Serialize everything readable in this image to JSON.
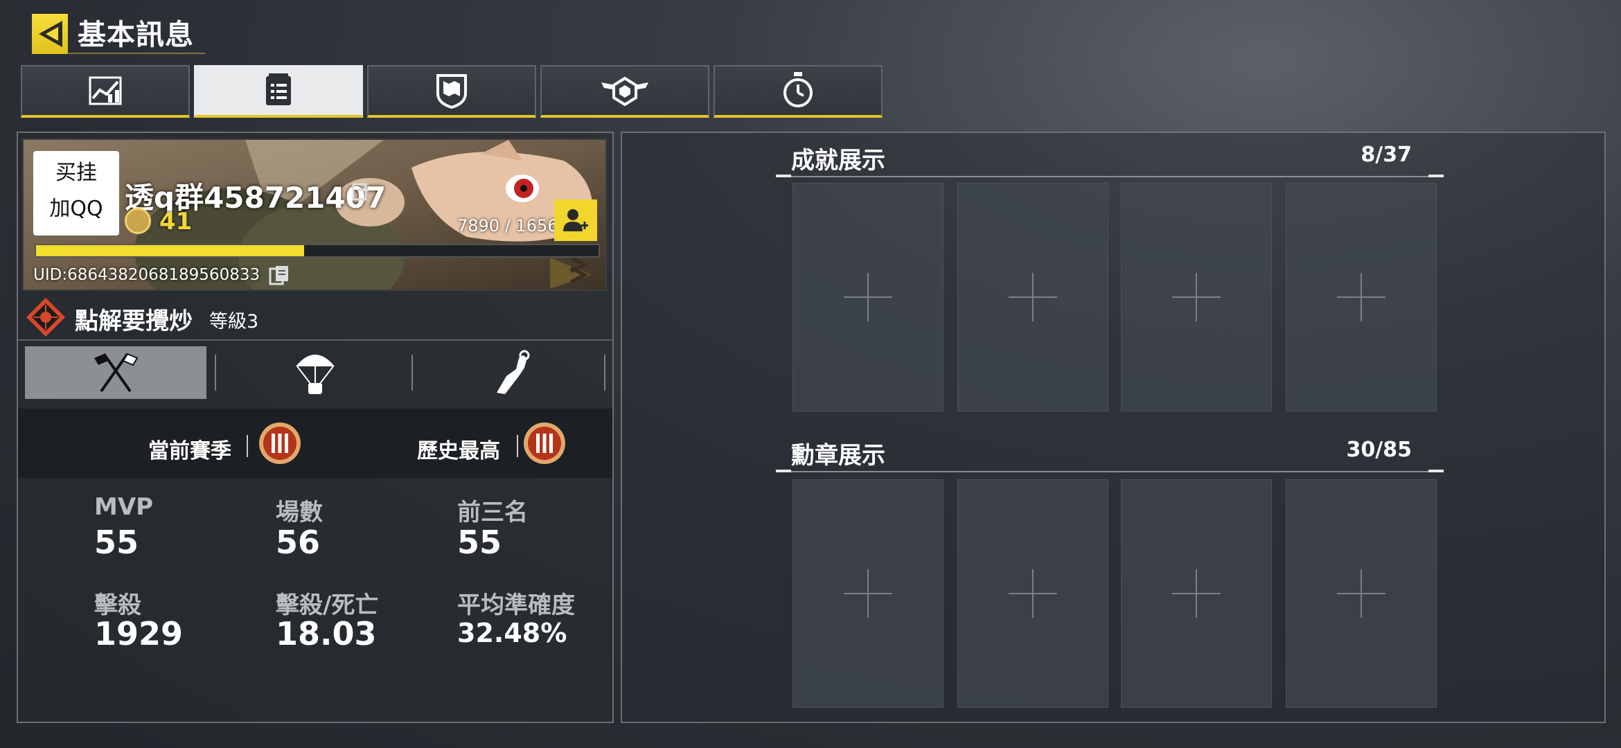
{
  "header": {
    "title": "基本訊息"
  },
  "tabs": [
    {
      "icon": "stats-chart-icon",
      "active": false
    },
    {
      "icon": "document-list-icon",
      "active": true
    },
    {
      "icon": "map-shield-icon",
      "active": false
    },
    {
      "icon": "winged-badge-icon",
      "active": false
    },
    {
      "icon": "stopwatch-icon",
      "active": false
    }
  ],
  "profile": {
    "promo_line1": "买挂",
    "promo_line2": "加QQ",
    "name": "透q群458721407",
    "level": "41",
    "xp_text": "7890 / 16560",
    "xp_fraction": 0.476,
    "uid": "UID:6864382068189560833"
  },
  "clan": {
    "name": "點解要攪炒",
    "level": "等級3"
  },
  "mode_tabs": [
    {
      "icon": "crossed-flags-icon",
      "active": true
    },
    {
      "icon": "parachute-icon",
      "active": false
    },
    {
      "icon": "arm-icon",
      "active": false
    }
  ],
  "ranks": {
    "current_label": "當前賽季",
    "best_label": "歷史最高"
  },
  "stats": [
    {
      "label": "MVP",
      "value": "55"
    },
    {
      "label": "場數",
      "value": "56"
    },
    {
      "label": "前三名",
      "value": "55"
    },
    {
      "label": "擊殺",
      "value": "1929"
    },
    {
      "label": "擊殺/死亡",
      "value": "18.03"
    },
    {
      "label": "平均準確度",
      "value": "32.48%"
    }
  ],
  "achievements": {
    "title": "成就展示",
    "count": "8/37"
  },
  "medals": {
    "title": "勳章展示",
    "count": "30/85"
  },
  "colors": {
    "accent": "#f2dc2c",
    "panel_border": "#6b7076",
    "rank_badge": "#b5341a"
  }
}
